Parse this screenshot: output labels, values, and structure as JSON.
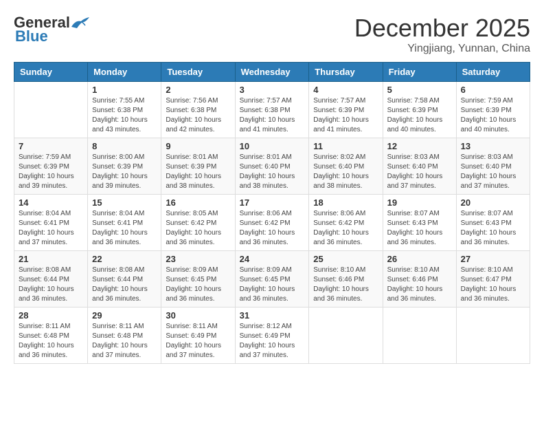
{
  "logo": {
    "general": "General",
    "blue": "Blue"
  },
  "header": {
    "month": "December 2025",
    "location": "Yingjiang, Yunnan, China"
  },
  "weekdays": [
    "Sunday",
    "Monday",
    "Tuesday",
    "Wednesday",
    "Thursday",
    "Friday",
    "Saturday"
  ],
  "weeks": [
    [
      {
        "day": "",
        "sunrise": "",
        "sunset": "",
        "daylight": ""
      },
      {
        "day": "1",
        "sunrise": "Sunrise: 7:55 AM",
        "sunset": "Sunset: 6:38 PM",
        "daylight": "Daylight: 10 hours and 43 minutes."
      },
      {
        "day": "2",
        "sunrise": "Sunrise: 7:56 AM",
        "sunset": "Sunset: 6:38 PM",
        "daylight": "Daylight: 10 hours and 42 minutes."
      },
      {
        "day": "3",
        "sunrise": "Sunrise: 7:57 AM",
        "sunset": "Sunset: 6:38 PM",
        "daylight": "Daylight: 10 hours and 41 minutes."
      },
      {
        "day": "4",
        "sunrise": "Sunrise: 7:57 AM",
        "sunset": "Sunset: 6:39 PM",
        "daylight": "Daylight: 10 hours and 41 minutes."
      },
      {
        "day": "5",
        "sunrise": "Sunrise: 7:58 AM",
        "sunset": "Sunset: 6:39 PM",
        "daylight": "Daylight: 10 hours and 40 minutes."
      },
      {
        "day": "6",
        "sunrise": "Sunrise: 7:59 AM",
        "sunset": "Sunset: 6:39 PM",
        "daylight": "Daylight: 10 hours and 40 minutes."
      }
    ],
    [
      {
        "day": "7",
        "sunrise": "Sunrise: 7:59 AM",
        "sunset": "Sunset: 6:39 PM",
        "daylight": "Daylight: 10 hours and 39 minutes."
      },
      {
        "day": "8",
        "sunrise": "Sunrise: 8:00 AM",
        "sunset": "Sunset: 6:39 PM",
        "daylight": "Daylight: 10 hours and 39 minutes."
      },
      {
        "day": "9",
        "sunrise": "Sunrise: 8:01 AM",
        "sunset": "Sunset: 6:39 PM",
        "daylight": "Daylight: 10 hours and 38 minutes."
      },
      {
        "day": "10",
        "sunrise": "Sunrise: 8:01 AM",
        "sunset": "Sunset: 6:40 PM",
        "daylight": "Daylight: 10 hours and 38 minutes."
      },
      {
        "day": "11",
        "sunrise": "Sunrise: 8:02 AM",
        "sunset": "Sunset: 6:40 PM",
        "daylight": "Daylight: 10 hours and 38 minutes."
      },
      {
        "day": "12",
        "sunrise": "Sunrise: 8:03 AM",
        "sunset": "Sunset: 6:40 PM",
        "daylight": "Daylight: 10 hours and 37 minutes."
      },
      {
        "day": "13",
        "sunrise": "Sunrise: 8:03 AM",
        "sunset": "Sunset: 6:40 PM",
        "daylight": "Daylight: 10 hours and 37 minutes."
      }
    ],
    [
      {
        "day": "14",
        "sunrise": "Sunrise: 8:04 AM",
        "sunset": "Sunset: 6:41 PM",
        "daylight": "Daylight: 10 hours and 37 minutes."
      },
      {
        "day": "15",
        "sunrise": "Sunrise: 8:04 AM",
        "sunset": "Sunset: 6:41 PM",
        "daylight": "Daylight: 10 hours and 36 minutes."
      },
      {
        "day": "16",
        "sunrise": "Sunrise: 8:05 AM",
        "sunset": "Sunset: 6:42 PM",
        "daylight": "Daylight: 10 hours and 36 minutes."
      },
      {
        "day": "17",
        "sunrise": "Sunrise: 8:06 AM",
        "sunset": "Sunset: 6:42 PM",
        "daylight": "Daylight: 10 hours and 36 minutes."
      },
      {
        "day": "18",
        "sunrise": "Sunrise: 8:06 AM",
        "sunset": "Sunset: 6:42 PM",
        "daylight": "Daylight: 10 hours and 36 minutes."
      },
      {
        "day": "19",
        "sunrise": "Sunrise: 8:07 AM",
        "sunset": "Sunset: 6:43 PM",
        "daylight": "Daylight: 10 hours and 36 minutes."
      },
      {
        "day": "20",
        "sunrise": "Sunrise: 8:07 AM",
        "sunset": "Sunset: 6:43 PM",
        "daylight": "Daylight: 10 hours and 36 minutes."
      }
    ],
    [
      {
        "day": "21",
        "sunrise": "Sunrise: 8:08 AM",
        "sunset": "Sunset: 6:44 PM",
        "daylight": "Daylight: 10 hours and 36 minutes."
      },
      {
        "day": "22",
        "sunrise": "Sunrise: 8:08 AM",
        "sunset": "Sunset: 6:44 PM",
        "daylight": "Daylight: 10 hours and 36 minutes."
      },
      {
        "day": "23",
        "sunrise": "Sunrise: 8:09 AM",
        "sunset": "Sunset: 6:45 PM",
        "daylight": "Daylight: 10 hours and 36 minutes."
      },
      {
        "day": "24",
        "sunrise": "Sunrise: 8:09 AM",
        "sunset": "Sunset: 6:45 PM",
        "daylight": "Daylight: 10 hours and 36 minutes."
      },
      {
        "day": "25",
        "sunrise": "Sunrise: 8:10 AM",
        "sunset": "Sunset: 6:46 PM",
        "daylight": "Daylight: 10 hours and 36 minutes."
      },
      {
        "day": "26",
        "sunrise": "Sunrise: 8:10 AM",
        "sunset": "Sunset: 6:46 PM",
        "daylight": "Daylight: 10 hours and 36 minutes."
      },
      {
        "day": "27",
        "sunrise": "Sunrise: 8:10 AM",
        "sunset": "Sunset: 6:47 PM",
        "daylight": "Daylight: 10 hours and 36 minutes."
      }
    ],
    [
      {
        "day": "28",
        "sunrise": "Sunrise: 8:11 AM",
        "sunset": "Sunset: 6:48 PM",
        "daylight": "Daylight: 10 hours and 36 minutes."
      },
      {
        "day": "29",
        "sunrise": "Sunrise: 8:11 AM",
        "sunset": "Sunset: 6:48 PM",
        "daylight": "Daylight: 10 hours and 37 minutes."
      },
      {
        "day": "30",
        "sunrise": "Sunrise: 8:11 AM",
        "sunset": "Sunset: 6:49 PM",
        "daylight": "Daylight: 10 hours and 37 minutes."
      },
      {
        "day": "31",
        "sunrise": "Sunrise: 8:12 AM",
        "sunset": "Sunset: 6:49 PM",
        "daylight": "Daylight: 10 hours and 37 minutes."
      },
      {
        "day": "",
        "sunrise": "",
        "sunset": "",
        "daylight": ""
      },
      {
        "day": "",
        "sunrise": "",
        "sunset": "",
        "daylight": ""
      },
      {
        "day": "",
        "sunrise": "",
        "sunset": "",
        "daylight": ""
      }
    ]
  ],
  "colors": {
    "header_bg": "#2c7bb6",
    "accent": "#2c7bb6"
  }
}
